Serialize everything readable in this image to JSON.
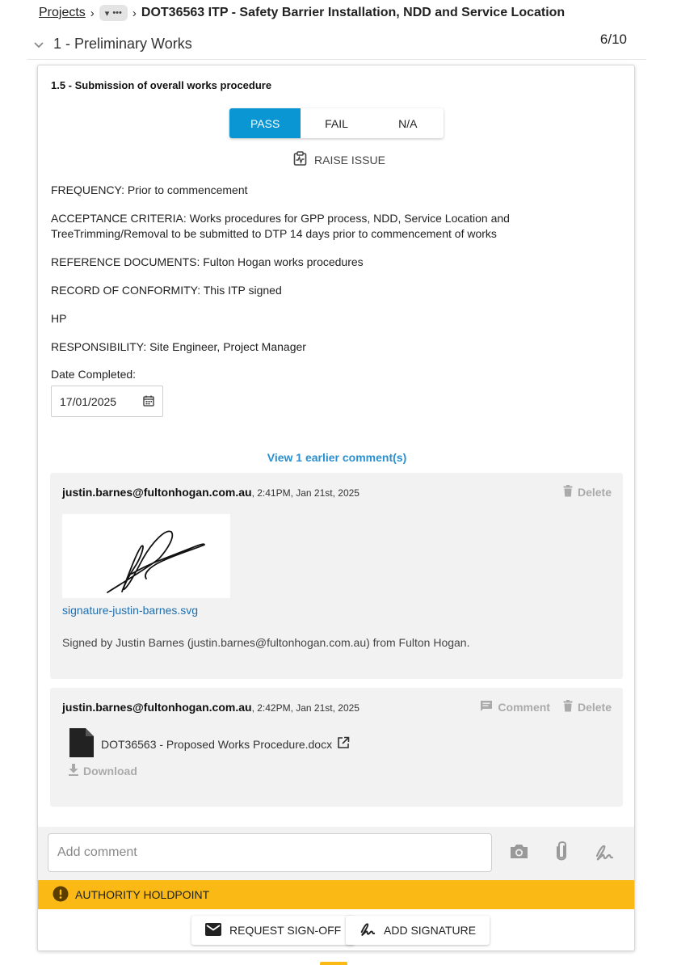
{
  "breadcrumb": {
    "projects": "Projects",
    "title": "DOT36563 ITP - Safety Barrier Installation, NDD and Service Location"
  },
  "section": {
    "title": "1 - Preliminary Works",
    "count": "6/10"
  },
  "item": {
    "title": "1.5 - Submission of overall works procedure",
    "options": [
      "PASS",
      "FAIL",
      "N/A"
    ],
    "selected": "PASS",
    "raise_issue": "RAISE ISSUE",
    "frequency": "FREQUENCY: Prior to commencement",
    "acceptance": "ACCEPTANCE CRITERIA: Works procedures for GPP process, NDD, Service Location and TreeTrimming/Removal to be submitted to DTP 14 days prior to commencement of works",
    "reference": "REFERENCE DOCUMENTS: Fulton Hogan works procedures",
    "record": "RECORD OF CONFORMITY: This ITP signed",
    "hp": "HP",
    "responsibility": "RESPONSIBILITY: Site Engineer, Project Manager",
    "date_label": "Date Completed:",
    "date_value": "17/01/2025"
  },
  "comments": {
    "view_earlier": "View 1 earlier comment(s)",
    "list": [
      {
        "author": "justin.barnes@fultonhogan.com.au",
        "time": ", 2:41PM, Jan 21st, 2025",
        "delete": "Delete",
        "file": "signature-justin-barnes.svg",
        "text": "Signed by Justin Barnes (justin.barnes@fultonhogan.com.au) from Fulton Hogan."
      },
      {
        "author": "justin.barnes@fultonhogan.com.au",
        "time": ", 2:42PM, Jan 21st, 2025",
        "comment": "Comment",
        "delete": "Delete",
        "file": "DOT36563 - Proposed Works Procedure.docx",
        "download": "Download"
      }
    ]
  },
  "add_comment": {
    "placeholder": "Add comment"
  },
  "holdpoint": "AUTHORITY HOLDPOINT",
  "footer": {
    "request_signoff": "REQUEST SIGN-OFF",
    "add_signature": "ADD SIGNATURE"
  },
  "colors": {
    "accent": "#0a96d3",
    "holdpoint": "#fbb915",
    "link": "#2a8fce"
  }
}
